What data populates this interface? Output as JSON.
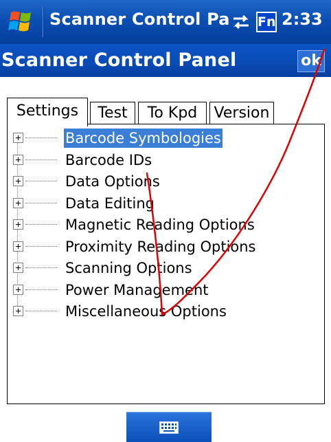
{
  "status_bar": {
    "title": "Scanner Control Pa",
    "fn_label": "Fn",
    "time": "2:33",
    "icons": [
      "windows-start-icon",
      "sync-icon"
    ]
  },
  "title_bar": {
    "title": "Scanner Control Panel",
    "ok_label": "ok"
  },
  "tabs": [
    {
      "label": "Settings",
      "active": true
    },
    {
      "label": "Test",
      "active": false
    },
    {
      "label": "To Kpd",
      "active": false
    },
    {
      "label": "Version",
      "active": false
    }
  ],
  "tree": {
    "items": [
      {
        "label": "Barcode Symbologies",
        "selected": true
      },
      {
        "label": "Barcode IDs",
        "selected": false
      },
      {
        "label": "Data Options",
        "selected": false
      },
      {
        "label": "Data Editing",
        "selected": false
      },
      {
        "label": "Magnetic Reading Options",
        "selected": false
      },
      {
        "label": "Proximity Reading Options",
        "selected": false
      },
      {
        "label": "Scanning Options",
        "selected": false
      },
      {
        "label": "Power Management",
        "selected": false
      },
      {
        "label": "Miscellaneous Options",
        "selected": false
      }
    ]
  },
  "bottom_bar": {
    "icon": "keyboard-icon"
  },
  "colors": {
    "bar_blue": "#0a4bb5",
    "selection_blue": "#3a7ed6",
    "annotation_red": "#e00000"
  }
}
